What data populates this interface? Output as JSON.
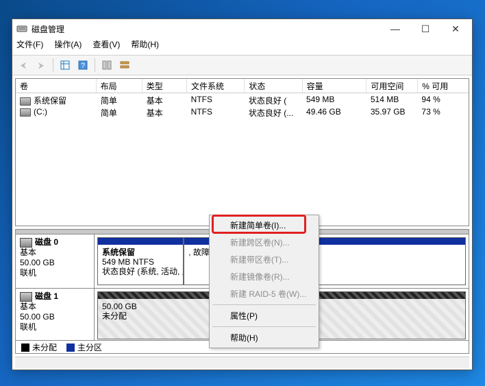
{
  "window": {
    "title": "磁盘管理",
    "min": "—",
    "max": "☐",
    "close": "✕"
  },
  "menu": {
    "file": "文件(F)",
    "action": "操作(A)",
    "view": "查看(V)",
    "help": "帮助(H)"
  },
  "columns": {
    "volume": "卷",
    "layout": "布局",
    "type": "类型",
    "fs": "文件系统",
    "status": "状态",
    "capacity": "容量",
    "free": "可用空间",
    "pctfree": "% 可用"
  },
  "volumes": [
    {
      "name": "系统保留",
      "layout": "简单",
      "type": "基本",
      "fs": "NTFS",
      "status": "状态良好 (",
      "capacity": "549 MB",
      "free": "514 MB",
      "pct": "94 %"
    },
    {
      "name": "(C:)",
      "layout": "简单",
      "type": "基本",
      "fs": "NTFS",
      "status": "状态良好 (...",
      "capacity": "49.46 GB",
      "free": "35.97 GB",
      "pct": "73 %"
    }
  ],
  "disks": [
    {
      "label": "磁盘 0",
      "type": "基本",
      "size": "50.00 GB",
      "state": "联机",
      "parts": [
        {
          "kind": "primary",
          "title": "系统保留",
          "line2": "549 MB NTFS",
          "line3": "状态良好 (系统, 活动, 主分区)",
          "flex": 22
        },
        {
          "kind": "primary",
          "title": "",
          "line2": "",
          "line3": ", 故障转储, 主分区)",
          "flex": 78
        }
      ]
    },
    {
      "label": "磁盘 1",
      "type": "基本",
      "size": "50.00 GB",
      "state": "联机",
      "parts": [
        {
          "kind": "unalloc",
          "title": "",
          "line2": "50.00 GB",
          "line3": "未分配",
          "flex": 100
        }
      ]
    }
  ],
  "legend": {
    "unallocated": "未分配",
    "primary": "主分区"
  },
  "context_menu": {
    "items": [
      {
        "label": "新建简单卷(I)...",
        "enabled": true
      },
      {
        "label": "新建跨区卷(N)...",
        "enabled": false
      },
      {
        "label": "新建带区卷(T)...",
        "enabled": false
      },
      {
        "label": "新建镜像卷(R)...",
        "enabled": false
      },
      {
        "label": "新建 RAID-5 卷(W)...",
        "enabled": false
      }
    ],
    "properties": "属性(P)",
    "help": "帮助(H)"
  }
}
